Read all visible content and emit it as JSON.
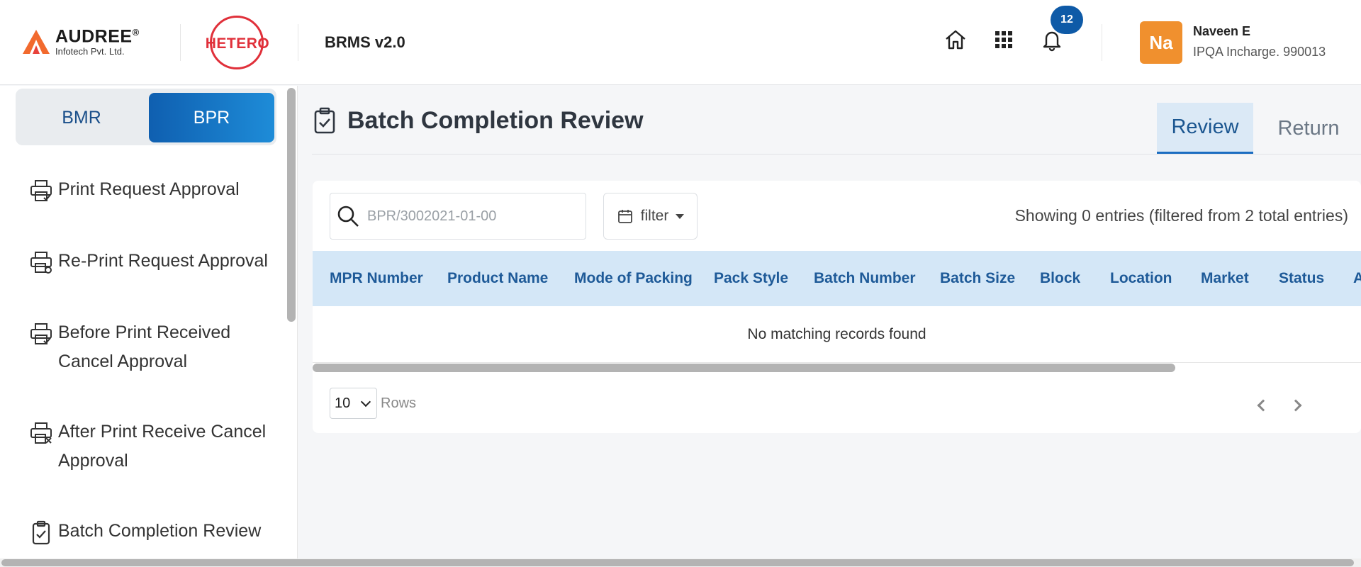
{
  "brand": {
    "company_name": "AUDREE",
    "company_reg": "®",
    "company_sub": "Infotech Pvt. Ltd.",
    "partner_name": "HETERO",
    "app_title": "BRMS v2.0"
  },
  "header": {
    "notification_count": "12",
    "user": {
      "initials": "Na",
      "name": "Naveen E",
      "role": "IPQA Incharge. 990013"
    }
  },
  "sidebar": {
    "segments": [
      {
        "label": "BMR",
        "active": false
      },
      {
        "label": "BPR",
        "active": true
      }
    ],
    "items": [
      {
        "label": "Print Request Approval",
        "icon": "printer-check-icon"
      },
      {
        "label": "Re-Print Request Approval",
        "icon": "printer-refresh-icon"
      },
      {
        "label": "Before Print Received Cancel Approval",
        "icon": "printer-check-icon"
      },
      {
        "label": "After Print Receive Cancel Approval",
        "icon": "printer-cancel-icon"
      },
      {
        "label": "Batch Completion Review",
        "icon": "clipboard-check-icon"
      }
    ]
  },
  "main": {
    "title": "Batch Completion Review",
    "tabs": [
      {
        "label": "Review",
        "active": true
      },
      {
        "label": "Return",
        "active": false
      }
    ],
    "search": {
      "placeholder": "BPR/3002021-01-00",
      "value": ""
    },
    "filter_label": "filter",
    "entries_info": "Showing 0 entries (filtered from 2 total entries)",
    "table": {
      "columns": [
        "MPR Number",
        "Product Name",
        "Mode of Packing",
        "Pack Style",
        "Batch Number",
        "Batch Size",
        "Block",
        "Location",
        "Market",
        "Status",
        "A"
      ],
      "empty_message": "No matching records found"
    },
    "rows_per_page": "10",
    "rows_label": "Rows"
  }
}
